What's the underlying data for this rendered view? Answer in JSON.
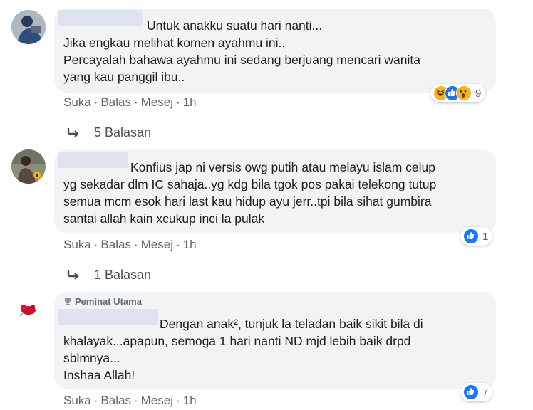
{
  "comments": [
    {
      "lines": [
        "Untuk anakku suatu hari nanti...",
        "Jika engkau melihat komen ayahmu ini..",
        "Percayalah bahawa ayahmu ini sedang berjuang mencari wanita",
        "yang kau panggil ibu.."
      ],
      "actions": {
        "like": "Suka",
        "reply": "Balas",
        "message": "Mesej",
        "time": "1h"
      },
      "reaction_icons": [
        "haha-emoji",
        "like-emoji",
        "wow-emoji"
      ],
      "reaction_count": "9",
      "replies_label": "5 Balasan"
    },
    {
      "lines": [
        "Konfius jap ni versis owg putih atau melayu islam celup",
        "yg sekadar dlm IC sahaja..yg kdg bila tgok pos pakai telekong tutup",
        "semua mcm esok hari last kau hidup ayu jerr..tpi bila sihat gumbira",
        "santai allah kain xcukup inci la pulak"
      ],
      "actions": {
        "like": "Suka",
        "reply": "Balas",
        "message": "Mesej",
        "time": "1h"
      },
      "reaction_icons": [
        "like-emoji"
      ],
      "reaction_count": "1",
      "replies_label": "1 Balasan"
    },
    {
      "badge": "Peminat Utama",
      "lines": [
        "Dengan anak², tunjuk la teladan baik sikit bila di",
        "khalayak...apapun, semoga 1 hari nanti ND mjd lebih baik drpd",
        "sblmnya...",
        "Inshaa Allah!"
      ],
      "actions": {
        "like": "Suka",
        "reply": "Balas",
        "message": "Mesej",
        "time": "1h"
      },
      "reaction_icons": [
        "like-emoji"
      ],
      "reaction_count": "7"
    }
  ],
  "colors": {
    "bubble": "#f2f3f5",
    "like_blue": "#1877f2",
    "text": "#1c1e21",
    "meta": "#606770"
  }
}
